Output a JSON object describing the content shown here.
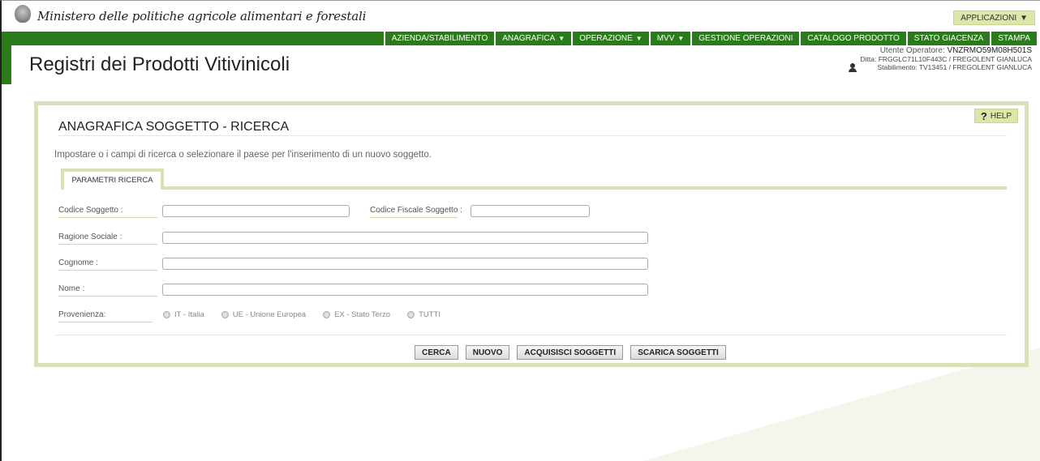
{
  "header": {
    "ministry": "Ministero delle politiche agricole alimentari e forestali",
    "apps_label": "APPLICAZIONI",
    "app_title": "Registri dei Prodotti Vitivinicoli"
  },
  "menu": [
    {
      "label": "AZIENDA/STABILIMENTO",
      "caret": false
    },
    {
      "label": "ANAGRAFICA",
      "caret": true
    },
    {
      "label": "OPERAZIONE",
      "caret": true
    },
    {
      "label": "MVV",
      "caret": true
    },
    {
      "label": "GESTIONE OPERAZIONI",
      "caret": false
    },
    {
      "label": "CATALOGO PRODOTTO",
      "caret": false
    },
    {
      "label": "STATO GIACENZA",
      "caret": false
    },
    {
      "label": "STAMPA",
      "caret": false
    }
  ],
  "user": {
    "operator_prefix": "Utente Operatore:",
    "operator_code": "VNZRMO59M08H501S",
    "ditta": "Ditta: FRGGLC71L10F443C / FREGOLENT GIANLUCA",
    "stabilimento": "Stabilimento: TV13451 / FREGOLENT GIANLUCA"
  },
  "panel": {
    "help_label": "HELP",
    "title": "ANAGRAFICA SOGGETTO - RICERCA",
    "instructions": "Impostare o i campi di ricerca o selezionare il paese per l'inserimento di un nuovo soggetto.",
    "tab_label": "PARAMETRI RICERCA"
  },
  "form": {
    "codice_soggetto": {
      "label": "Codice Soggetto :",
      "value": ""
    },
    "codice_fiscale": {
      "label": "Codice Fiscale Soggetto :",
      "value": ""
    },
    "ragione_sociale": {
      "label": "Ragione Sociale :",
      "value": ""
    },
    "cognome": {
      "label": "Cognome :",
      "value": ""
    },
    "nome": {
      "label": "Nome :",
      "value": ""
    },
    "provenienza": {
      "label": "Provenienza:",
      "options": [
        "IT - Italia",
        "UE - Unione Europea",
        "EX - Stato Terzo",
        "TUTTI"
      ]
    }
  },
  "actions": {
    "cerca": "CERCA",
    "nuovo": "NUOVO",
    "acquisisci": "ACQUISISCI SOGGETTI",
    "scarica": "SCARICA SOGGETTI"
  },
  "colors": {
    "brand_green": "#2a7c1a",
    "accent_light_green": "#d8e2b6",
    "button_light_green": "#dbe6a8"
  }
}
